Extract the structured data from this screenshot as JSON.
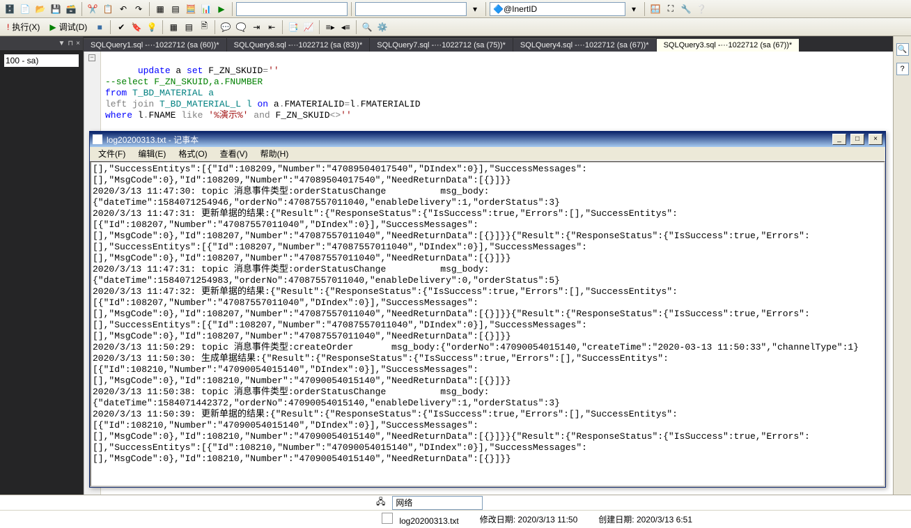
{
  "toolbar1": {
    "combo_param": "@InertID"
  },
  "toolbar2": {
    "execute": "执行(X)",
    "debug": "调试(D)"
  },
  "sidebar": {
    "pin": "▼  ⊓  ×",
    "label": "100 - sa)"
  },
  "tabs": [
    {
      "label": "SQLQuery1.sql -···1022712 (sa (60))*"
    },
    {
      "label": "SQLQuery8.sql -···1022712 (sa (83))*"
    },
    {
      "label": "SQLQuery7.sql -···1022712 (sa (75))*"
    },
    {
      "label": "SQLQuery4.sql -···1022712 (sa (67))*"
    },
    {
      "label": "SQLQuery3.sql -···1022712 (sa (67))*"
    }
  ],
  "sql": {
    "l1a": "update",
    "l1b": " a ",
    "l1c": "set",
    "l1d": " F_ZN_SKUID",
    "l1e": "=",
    "l1f": "''",
    "l2": "--select F_ZN_SKUID,a.FNUMBER",
    "l3a": "from",
    "l3b": " T_BD_MATERIAL a",
    "l4a": "left",
    "l4b": " join",
    "l4c": " T_BD_MATERIAL_L l ",
    "l4d": "on",
    "l4e": " a",
    "l4f": ".",
    "l4g": "FMATERIALID",
    "l4h": "=",
    "l4i": "l",
    "l4j": ".",
    "l4k": "FMATERIALID",
    "l5a": "where",
    "l5b": " l",
    "l5c": ".",
    "l5d": "FNAME ",
    "l5e": "like",
    "l5f": " '%演示%'",
    "l5g": " and",
    "l5h": " F_ZN_SKUID",
    "l5i": "<>",
    "l5j": "''"
  },
  "notepad": {
    "title": "log20200313.txt - 记事本",
    "menu": [
      "文件(F)",
      "编辑(E)",
      "格式(O)",
      "查看(V)",
      "帮助(H)"
    ],
    "content": "[],\"SuccessEntitys\":[{\"Id\":108209,\"Number\":\"47089504017540\",\"DIndex\":0}],\"SuccessMessages\":\n[],\"MsgCode\":0},\"Id\":108209,\"Number\":\"47089504017540\",\"NeedReturnData\":[{}]}}\n2020/3/13 11:47:30: topic 消息事件类型:orderStatusChange          msg_body:\n{\"dateTime\":1584071254946,\"orderNo\":47087557011040,\"enableDelivery\":1,\"orderStatus\":3}\n2020/3/13 11:47:31: 更新单据的结果:{\"Result\":{\"ResponseStatus\":{\"IsSuccess\":true,\"Errors\":[],\"SuccessEntitys\":\n[{\"Id\":108207,\"Number\":\"47087557011040\",\"DIndex\":0}],\"SuccessMessages\":\n[],\"MsgCode\":0},\"Id\":108207,\"Number\":\"47087557011040\",\"NeedReturnData\":[{}]}}{\"Result\":{\"ResponseStatus\":{\"IsSuccess\":true,\"Errors\":\n[],\"SuccessEntitys\":[{\"Id\":108207,\"Number\":\"47087557011040\",\"DIndex\":0}],\"SuccessMessages\":\n[],\"MsgCode\":0},\"Id\":108207,\"Number\":\"47087557011040\",\"NeedReturnData\":[{}]}}\n2020/3/13 11:47:31: topic 消息事件类型:orderStatusChange          msg_body:\n{\"dateTime\":1584071254983,\"orderNo\":47087557011040,\"enableDelivery\":0,\"orderStatus\":5}\n2020/3/13 11:47:32: 更新单据的结果:{\"Result\":{\"ResponseStatus\":{\"IsSuccess\":true,\"Errors\":[],\"SuccessEntitys\":\n[{\"Id\":108207,\"Number\":\"47087557011040\",\"DIndex\":0}],\"SuccessMessages\":\n[],\"MsgCode\":0},\"Id\":108207,\"Number\":\"47087557011040\",\"NeedReturnData\":[{}]}}{\"Result\":{\"ResponseStatus\":{\"IsSuccess\":true,\"Errors\":\n[],\"SuccessEntitys\":[{\"Id\":108207,\"Number\":\"47087557011040\",\"DIndex\":0}],\"SuccessMessages\":\n[],\"MsgCode\":0},\"Id\":108207,\"Number\":\"47087557011040\",\"NeedReturnData\":[{}]}}\n2020/3/13 11:50:29: topic 消息事件类型:createOrder       msg_body:{\"orderNo\":47090054015140,\"createTime\":\"2020-03-13 11:50:33\",\"channelType\":1}\n2020/3/13 11:50:30: 生成单据结果:{\"Result\":{\"ResponseStatus\":{\"IsSuccess\":true,\"Errors\":[],\"SuccessEntitys\":\n[{\"Id\":108210,\"Number\":\"47090054015140\",\"DIndex\":0}],\"SuccessMessages\":\n[],\"MsgCode\":0},\"Id\":108210,\"Number\":\"47090054015140\",\"NeedReturnData\":[{}]}}\n2020/3/13 11:50:38: topic 消息事件类型:orderStatusChange          msg_body:\n{\"dateTime\":1584071442372,\"orderNo\":47090054015140,\"enableDelivery\":1,\"orderStatus\":3}\n2020/3/13 11:50:39: 更新单据的结果:{\"Result\":{\"ResponseStatus\":{\"IsSuccess\":true,\"Errors\":[],\"SuccessEntitys\":\n[{\"Id\":108210,\"Number\":\"47090054015140\",\"DIndex\":0}],\"SuccessMessages\":\n[],\"MsgCode\":0},\"Id\":108210,\"Number\":\"47090054015140\",\"NeedReturnData\":[{}]}}{\"Result\":{\"ResponseStatus\":{\"IsSuccess\":true,\"Errors\":\n[],\"SuccessEntitys\":[{\"Id\":108210,\"Number\":\"47090054015140\",\"DIndex\":0}],\"SuccessMessages\":\n[],\"MsgCode\":0},\"Id\":108210,\"Number\":\"47090054015140\",\"NeedReturnData\":[{}]}}"
  },
  "bottom": {
    "net_label": "网络",
    "file_name": "log20200313.txt",
    "mod_label": "修改日期: 2020/3/13 11:50",
    "create_label": "创建日期: 2020/3/13 6:51"
  }
}
